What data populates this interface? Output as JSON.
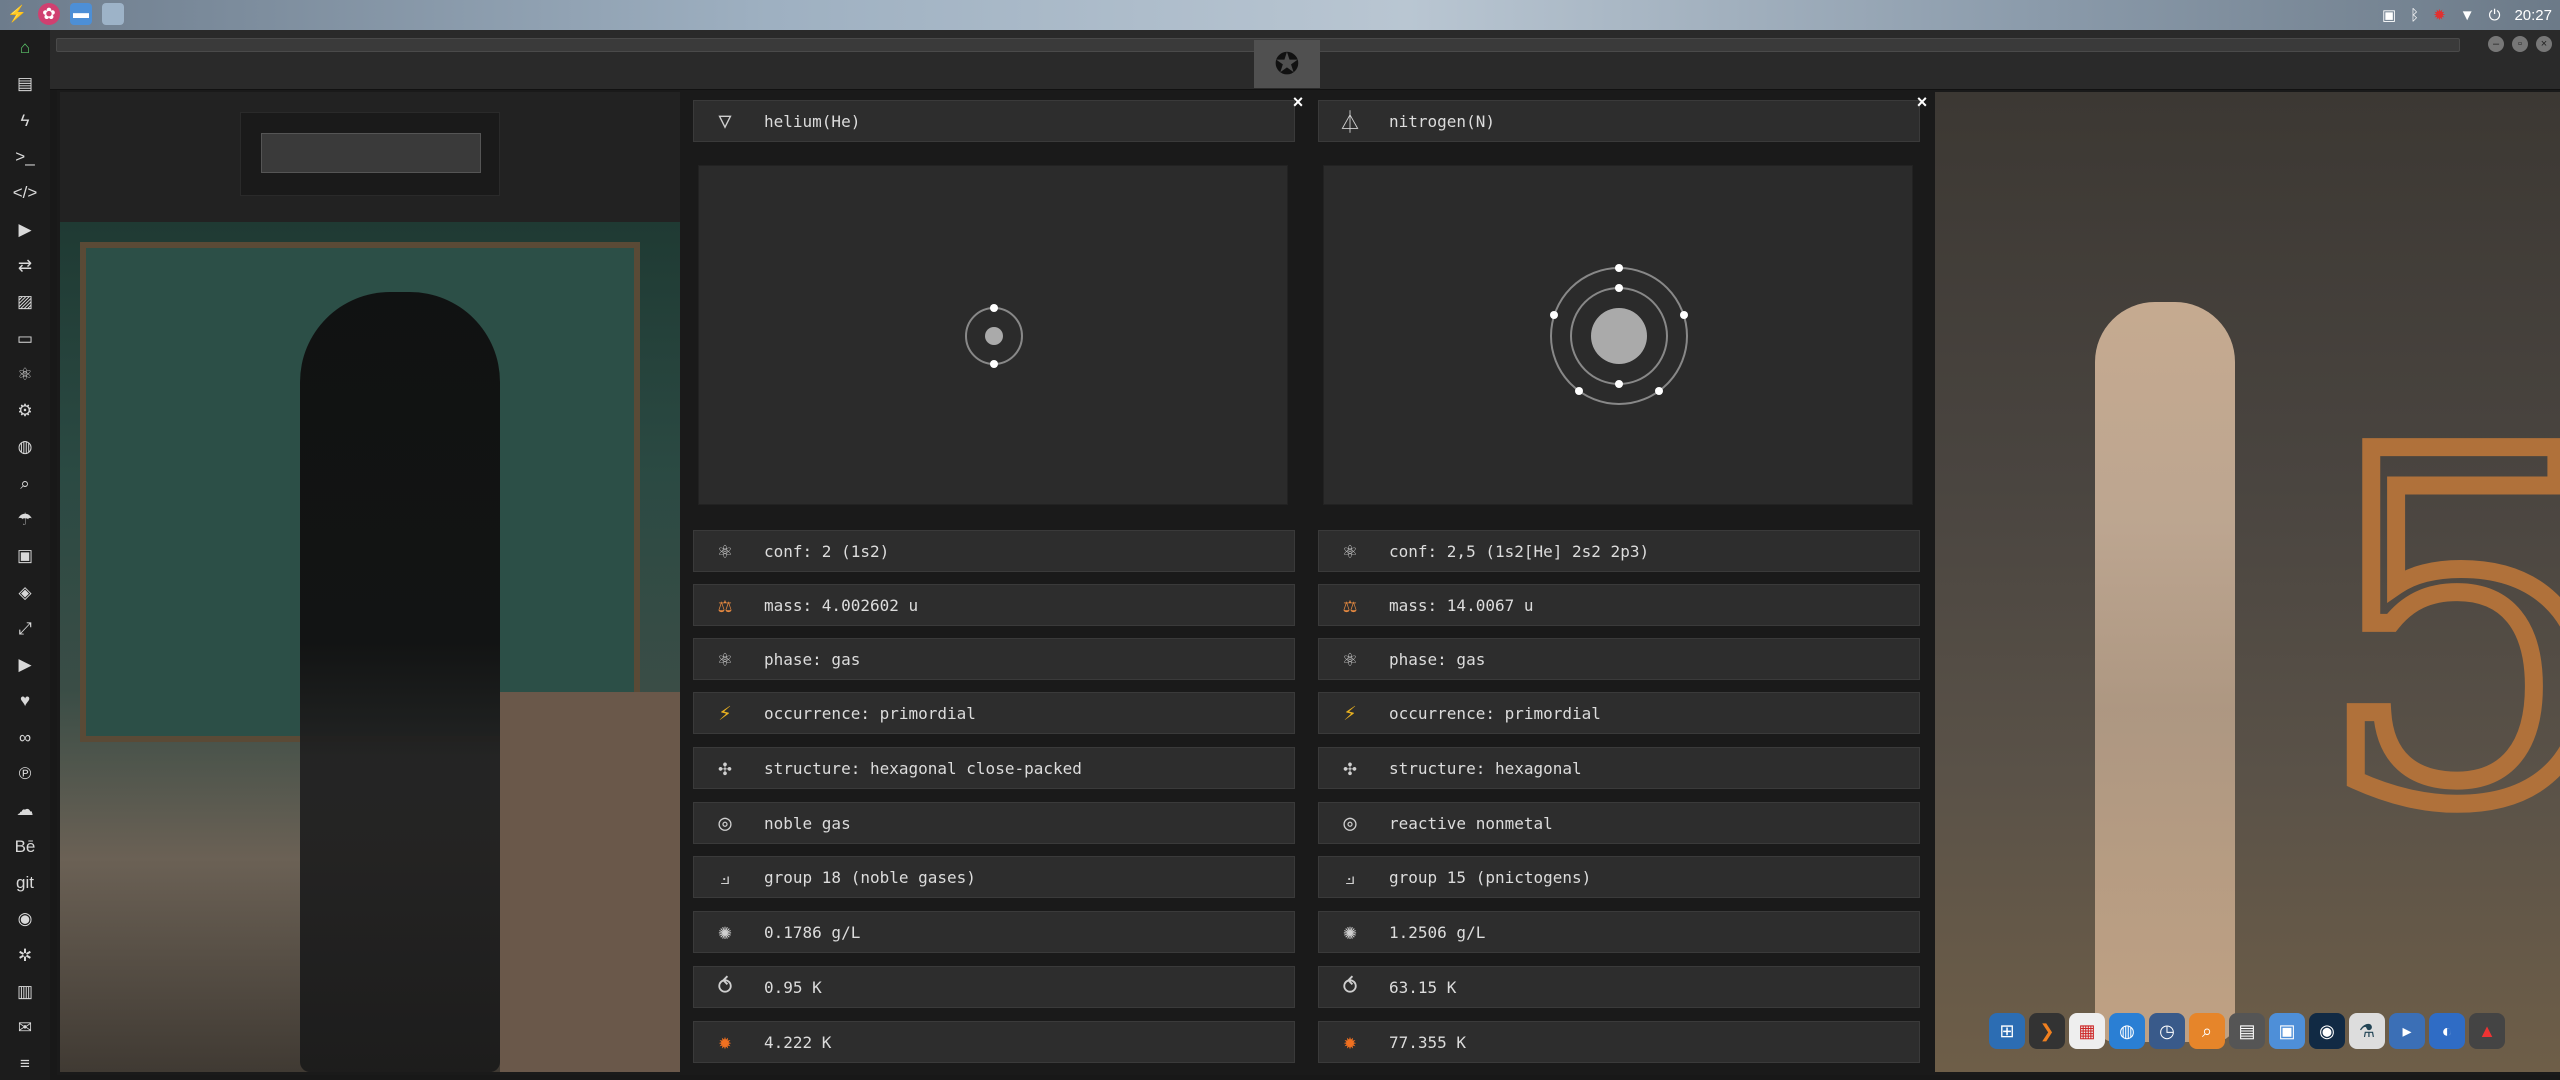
{
  "topbar": {
    "clock": "20:27",
    "left_icons": [
      "bolt-icon",
      "gear-icon",
      "folder-icon",
      "window-icon"
    ],
    "right_icons": [
      "image-icon",
      "bluetooth-icon",
      "debian-icon",
      "wifi-icon",
      "power-icon"
    ]
  },
  "dock": {
    "items": [
      "home-icon",
      "document-icon",
      "bolt-icon",
      "terminal-icon",
      "code-icon",
      "play-icon",
      "translate-icon",
      "image-icon",
      "card-icon",
      "atom-icon",
      "gear-icon",
      "globe-icon",
      "search-icon",
      "umbrella-icon",
      "contact-icon",
      "tag-icon",
      "expand-icon",
      "youtube-icon",
      "heart-icon",
      "link-icon",
      "pinterest-icon",
      "cloud-icon",
      "behance-icon",
      "git-icon",
      "github-icon",
      "network-icon",
      "map-icon",
      "mail-icon",
      "list-icon"
    ],
    "labels": {
      "behance": "Bē",
      "git": "git"
    }
  },
  "window": {
    "logo_glyph": "✪"
  },
  "panel_left": {
    "name": "helium(He)",
    "close": "×",
    "rows": [
      {
        "icon": "atom-icon",
        "text": "conf: 2 (1s2)"
      },
      {
        "icon": "mass-icon",
        "text": "mass: 4.002602 u"
      },
      {
        "icon": "phase-icon",
        "text": "phase: gas"
      },
      {
        "icon": "bolt-icon",
        "text": "occurrence: primordial"
      },
      {
        "icon": "structure-icon",
        "text": "structure: hexagonal close-packed"
      },
      {
        "icon": "category-icon",
        "text": "noble gas"
      },
      {
        "icon": "group-icon",
        "text": "group 18 (noble gases)"
      },
      {
        "icon": "density-icon",
        "text": "0.1786 g/L"
      },
      {
        "icon": "melting-icon",
        "text": "0.95 K"
      },
      {
        "icon": "boiling-icon",
        "text": "4.222 K"
      }
    ],
    "shells": [
      2
    ]
  },
  "panel_right": {
    "name": "nitrogen(N)",
    "close": "×",
    "rows": [
      {
        "icon": "atom-icon",
        "text": "conf: 2,5 (1s2[He] 2s2 2p3)"
      },
      {
        "icon": "mass-icon",
        "text": "mass: 14.0067 u"
      },
      {
        "icon": "phase-icon",
        "text": "phase: gas"
      },
      {
        "icon": "bolt-icon",
        "text": "occurrence: primordial"
      },
      {
        "icon": "structure-icon",
        "text": "structure: hexagonal"
      },
      {
        "icon": "category-icon",
        "text": "reactive nonmetal"
      },
      {
        "icon": "group-icon",
        "text": "group 15 (pnictogens)"
      },
      {
        "icon": "density-icon",
        "text": "1.2506 g/L"
      },
      {
        "icon": "melting-icon",
        "text": "63.15 K"
      },
      {
        "icon": "boiling-icon",
        "text": "77.355 K"
      }
    ],
    "shells": [
      2,
      5
    ]
  },
  "app_dock": [
    "apps-icon",
    "arrow-icon",
    "calendar-icon",
    "globe-icon",
    "clock-icon",
    "search-icon",
    "window-icon",
    "photo-icon",
    "earth-icon",
    "flask-icon",
    "terminal-icon",
    "browser-icon",
    "warning-icon"
  ]
}
